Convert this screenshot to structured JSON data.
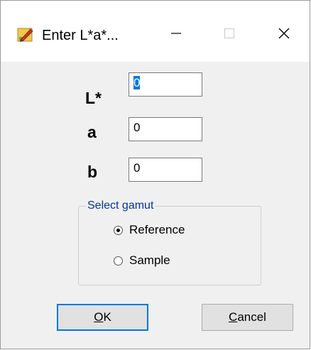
{
  "window": {
    "title": "Enter L*a*..."
  },
  "titlebar": {
    "icons": {
      "app": "edit-color-icon",
      "minimize": "minimize-icon",
      "maximize": "maximize-icon",
      "close": "close-icon"
    }
  },
  "fields": {
    "l": {
      "label": "L*",
      "value": "0"
    },
    "a": {
      "label": "a",
      "value": "0"
    },
    "b": {
      "label": "b",
      "value": "0"
    }
  },
  "gamut": {
    "title": "Select gamut",
    "options": [
      {
        "label": "Reference",
        "selected": true
      },
      {
        "label": "Sample",
        "selected": false
      }
    ]
  },
  "buttons": {
    "ok_mnemonic": "O",
    "ok_rest": "K",
    "cancel_mnemonic": "C",
    "cancel_rest": "ancel"
  },
  "colors": {
    "accent": "#0078d7",
    "group_title": "#0033a0"
  }
}
